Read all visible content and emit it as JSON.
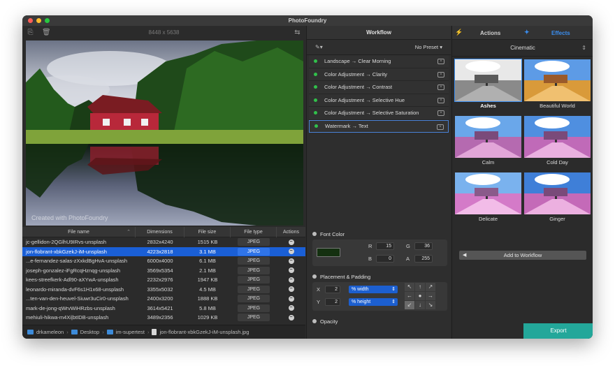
{
  "app": {
    "title": "PhotoFoundry"
  },
  "left": {
    "image_dimensions": "8448 x 5638",
    "watermark_text": "Created with PhotoFoundry",
    "table": {
      "headers": [
        "File name",
        "Dimensions",
        "File size",
        "File type",
        "Actions"
      ],
      "rows": [
        {
          "name": "jc-gellidon-2QGlhU9IRvs-unsplash",
          "dims": "2832x4240",
          "size": "1515 KB",
          "type": "JPEG"
        },
        {
          "name": "jon-flobrant-xbkGzekJ-iM-unsplash",
          "dims": "4223x2818",
          "size": "3.1 MB",
          "type": "JPEG",
          "selected": true
        },
        {
          "name": "...e-fernandez-salas-zXxkdBgHvA-unsplash",
          "dims": "6000x4000",
          "size": "6.1 MB",
          "type": "JPEG"
        },
        {
          "name": "joseph-gonzalez-iFgRcqHznqg-unsplash",
          "dims": "3569x5354",
          "size": "2.1 MB",
          "type": "JPEG"
        },
        {
          "name": "kees-streefkerk-Adl90-aXYwA-unsplash",
          "dims": "2232x2976",
          "size": "1947 KB",
          "type": "JPEG"
        },
        {
          "name": "leonardo-miranda-dvF6s1H1x68-unsplash",
          "dims": "3355x5032",
          "size": "4.5 MB",
          "type": "JPEG"
        },
        {
          "name": "...ten-van-den-heuvel-Siuwr3uCir0-unsplash",
          "dims": "2400x3200",
          "size": "1888 KB",
          "type": "JPEG"
        },
        {
          "name": "mark-de-jong-qWrvWiHRzbs-unsplash",
          "dims": "3614x5421",
          "size": "5.8 MB",
          "type": "JPEG"
        },
        {
          "name": "mehiuli-hikwa-m4Xi|btIDB-unsplash",
          "dims": "3489x2356",
          "size": "1029 KB",
          "type": "JPEG"
        }
      ]
    },
    "path": [
      "drkameleon",
      "Desktop",
      "im-supertest",
      "jon-flobrant-xbkGzekJ-iM-unsplash.jpg"
    ]
  },
  "workflow": {
    "header": "Workflow",
    "preset": "No Preset",
    "items": [
      "Landscape → Clear Morning",
      "Color Adjustment → Clarity",
      "Color Adjustment → Contrast",
      "Color Adjustment → Selective Hue",
      "Color Adjustment → Selective Saturation",
      "Watermark → Text"
    ],
    "font_color": {
      "title": "Font Color",
      "swatch_color": "#143010",
      "r_label": "R",
      "r": "15",
      "g_label": "G",
      "g": "36",
      "b_label": "B",
      "b": "0",
      "a_label": "A",
      "a": "255"
    },
    "placement": {
      "title": "Placement & Padding",
      "x_label": "X",
      "x": "2",
      "x_unit": "% width",
      "y_label": "Y",
      "y": "2",
      "y_unit": "% height"
    },
    "opacity": {
      "title": "Opacity"
    }
  },
  "effects": {
    "tabs": {
      "actions": "Actions",
      "effects": "Effects"
    },
    "category": "Cinematic",
    "thumbs": [
      {
        "label": "Ashes",
        "selected": true
      },
      {
        "label": "Beautiful World"
      },
      {
        "label": "Calm"
      },
      {
        "label": "Cold Day"
      },
      {
        "label": "Delicate"
      },
      {
        "label": "Ginger"
      }
    ],
    "add_button": "Add to Workflow",
    "export_button": "Export"
  },
  "colors": {
    "accent": "#3a8ef0",
    "selection": "#1a5fd6",
    "export": "#23a79a",
    "active_dot": "#31c04b"
  }
}
